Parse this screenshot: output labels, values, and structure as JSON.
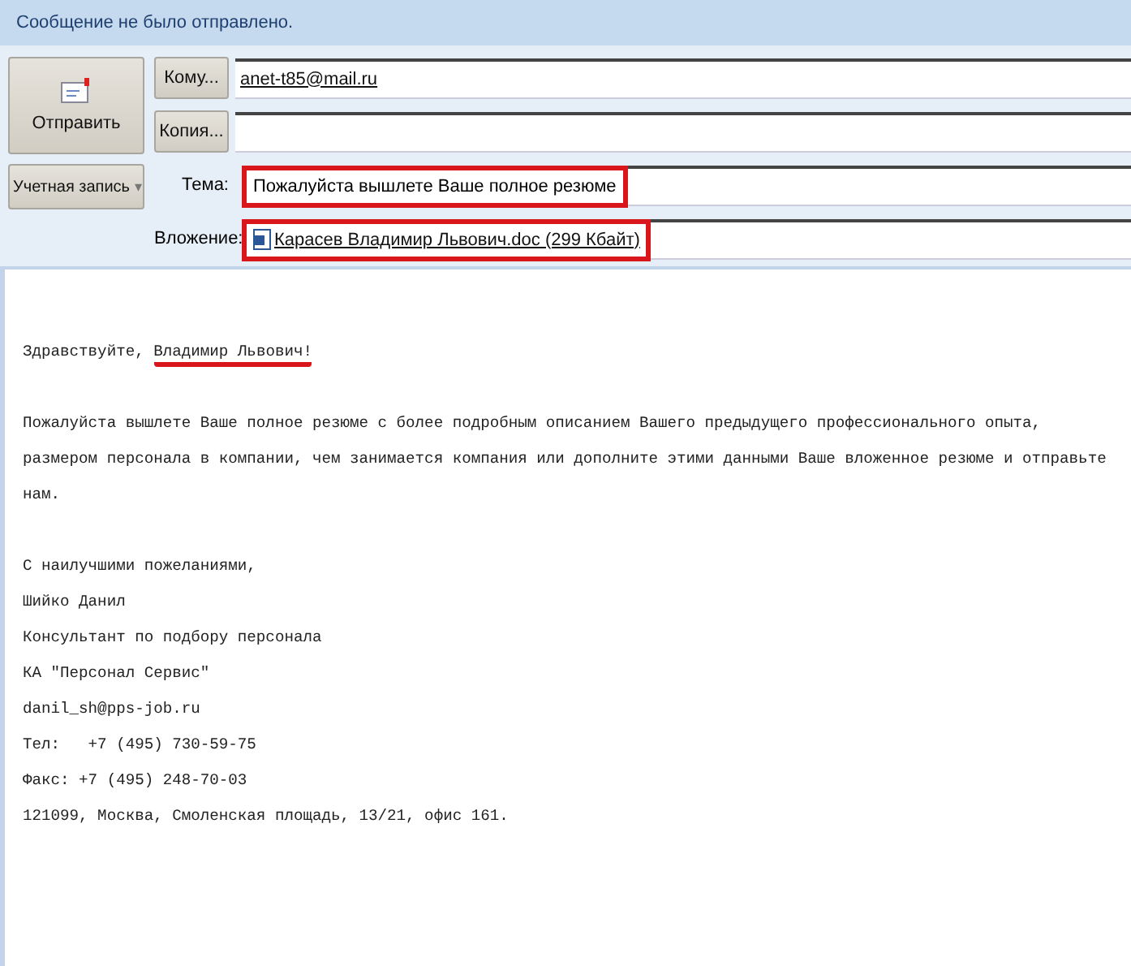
{
  "info_bar": {
    "text": "Сообщение не было отправлено."
  },
  "send_button": {
    "label": "Отправить"
  },
  "account_button": {
    "label": "Учетная запись",
    "caret": "▾"
  },
  "fields": [
    {
      "kind": "address",
      "button": "Кому...",
      "value": "anet-t85@mail.ru",
      "highlighted": false
    },
    {
      "kind": "address",
      "button": "Копия...",
      "highlighted": false
    },
    {
      "kind": "subject",
      "label": "Тема:",
      "value": "Пожалуйста вышлете Ваше полное резюме",
      "highlighted": true
    },
    {
      "kind": "attachment",
      "label": "Вложение:",
      "value": "Карасев Владимир Львович.doc (299 Кбайт)",
      "highlighted": true
    }
  ],
  "body": {
    "greeting": {
      "prefix": "Здравствуйте, ",
      "name": "Владимир Львович!",
      "underlined": true
    },
    "paragraph": [
      "Пожалуйста вышлете Ваше полное резюме с более подробным описанием Вашего предыдущего профессионального опыта,",
      "размером персонала в компании, чем занимается компания или дополните этими данными Ваше вложенное резюме и отправьте",
      "нам."
    ],
    "signature": [
      "С наилучшими пожеланиями,",
      "Шийко Данил",
      "Консультант по подбору персонала",
      "КА \"Персонал Сервис\""
    ],
    "contacts": [
      "danil_sh@pps-job.ru",
      "Тел:   +7 (495) 730-59-75",
      "Факс: +7 (495) 248-70-03",
      "121099, Москва, Смоленская площадь, 13/21, офис 161."
    ]
  }
}
